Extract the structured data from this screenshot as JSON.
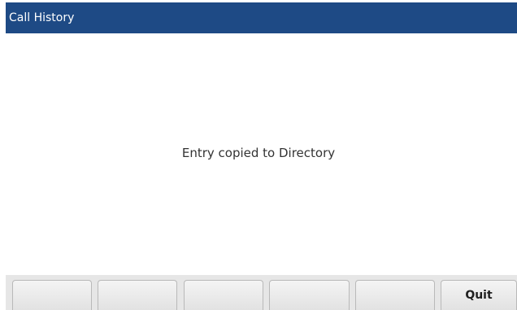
{
  "header": {
    "title": "Call History"
  },
  "main": {
    "message": "Entry copied to Directory"
  },
  "softkeys": [
    {
      "label": ""
    },
    {
      "label": ""
    },
    {
      "label": ""
    },
    {
      "label": ""
    },
    {
      "label": ""
    },
    {
      "label": "Quit"
    }
  ],
  "colors": {
    "title_bar": "#1e4a85",
    "softkey_bar": "#e6e6e6"
  }
}
